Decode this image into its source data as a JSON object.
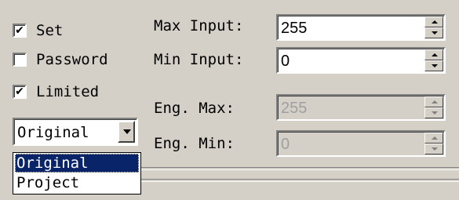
{
  "checkboxes": [
    {
      "label": "Set",
      "checked": true
    },
    {
      "label": "Password",
      "checked": false
    },
    {
      "label": "Limited",
      "checked": true
    }
  ],
  "checkmark_glyph": "✔",
  "combo": {
    "selected": "Original",
    "options": [
      "Original",
      "Project"
    ],
    "highlighted_option": "Original"
  },
  "fields": {
    "max_input": {
      "label": "Max Input:",
      "value": "255",
      "enabled": true
    },
    "min_input": {
      "label": "Min Input:",
      "value": "0",
      "enabled": true
    },
    "eng_max": {
      "label": "Eng. Max:",
      "value": "255",
      "enabled": false
    },
    "eng_min": {
      "label": "Eng. Min:",
      "value": "0",
      "enabled": false
    }
  },
  "colors": {
    "window_bg": "#d4d0c8",
    "selection_bg": "#0a246a",
    "disabled_text": "#a0a0a0"
  }
}
